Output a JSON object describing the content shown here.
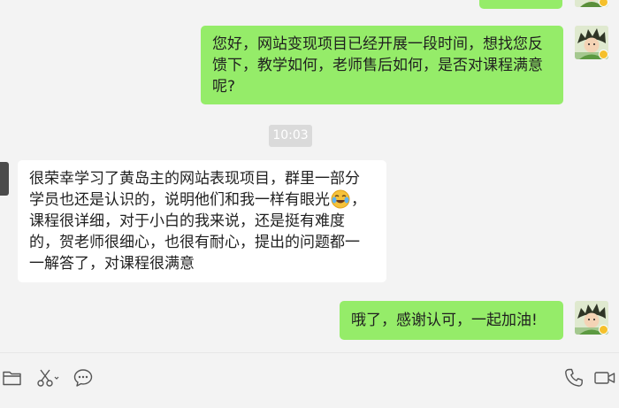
{
  "chat": {
    "timestamp": "10:03",
    "messages": [
      {
        "side": "sent",
        "lines": [
          "您好，网站变现项目已经开展一段时间，想找您反",
          "馈下，教学如何，老师售后如何，是否对课程满意",
          "呢?"
        ]
      },
      {
        "side": "received",
        "lines": [
          "很荣幸学习了黄岛主的网站表现项目，群里一部分",
          "学员也还是认识的，说明他们和我一样有眼光",
          "，",
          "课程很详细，对于小白的我来说，还是挺有难度",
          "的，贺老师很细心，也很有耐心，提出的问题都一",
          "一解答了，对课程很满意"
        ],
        "emoji": "laughing-tears-emoji"
      },
      {
        "side": "sent",
        "lines": [
          "哦了，感谢认可，一起加油!"
        ]
      }
    ]
  },
  "toolbar": {
    "left": [
      "folder-icon",
      "scissors-icon",
      "chat-bubble-icon"
    ],
    "right": [
      "phone-icon",
      "video-icon"
    ]
  },
  "colors": {
    "sent_bubble": "#95ec69",
    "received_bubble": "#ffffff",
    "background": "#f3f3f3",
    "timestamp_bg": "#dadada"
  }
}
